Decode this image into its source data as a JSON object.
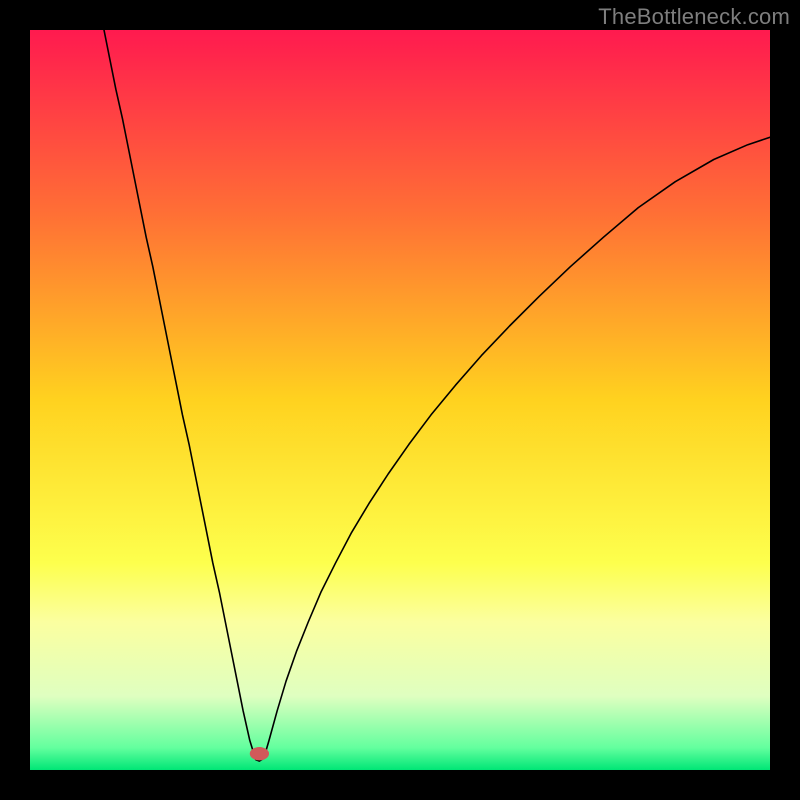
{
  "watermark": "TheBottleneck.com",
  "chart_data": {
    "type": "line",
    "title": "",
    "xlabel": "",
    "ylabel": "",
    "xlim": [
      0,
      100
    ],
    "ylim": [
      0,
      100
    ],
    "grid": false,
    "gradient_stops": [
      {
        "offset": 0,
        "color": "#ff1a4f"
      },
      {
        "offset": 0.25,
        "color": "#ff7035"
      },
      {
        "offset": 0.5,
        "color": "#ffd21f"
      },
      {
        "offset": 0.72,
        "color": "#fdff4d"
      },
      {
        "offset": 0.8,
        "color": "#fbffa0"
      },
      {
        "offset": 0.9,
        "color": "#dfffc0"
      },
      {
        "offset": 0.97,
        "color": "#63ff9e"
      },
      {
        "offset": 1.0,
        "color": "#00e676"
      }
    ],
    "marker": {
      "x": 31,
      "y": 2.2,
      "rx": 1.3,
      "ry": 0.9,
      "color": "#d05a5a"
    },
    "series": [
      {
        "name": "curve",
        "stroke": "#000000",
        "stroke_width": 1.6,
        "points": [
          {
            "x": 10.0,
            "y": 100.0
          },
          {
            "x": 10.8,
            "y": 96.0
          },
          {
            "x": 11.6,
            "y": 92.0
          },
          {
            "x": 12.5,
            "y": 88.0
          },
          {
            "x": 13.3,
            "y": 84.0
          },
          {
            "x": 14.1,
            "y": 80.0
          },
          {
            "x": 14.9,
            "y": 76.0
          },
          {
            "x": 15.7,
            "y": 72.0
          },
          {
            "x": 16.6,
            "y": 68.0
          },
          {
            "x": 17.4,
            "y": 64.0
          },
          {
            "x": 18.2,
            "y": 60.0
          },
          {
            "x": 19.0,
            "y": 56.0
          },
          {
            "x": 19.8,
            "y": 52.0
          },
          {
            "x": 20.6,
            "y": 48.0
          },
          {
            "x": 21.5,
            "y": 44.0
          },
          {
            "x": 22.3,
            "y": 40.0
          },
          {
            "x": 23.1,
            "y": 36.0
          },
          {
            "x": 23.9,
            "y": 32.0
          },
          {
            "x": 24.7,
            "y": 28.0
          },
          {
            "x": 25.6,
            "y": 24.0
          },
          {
            "x": 26.4,
            "y": 20.0
          },
          {
            "x": 27.2,
            "y": 16.0
          },
          {
            "x": 28.0,
            "y": 12.0
          },
          {
            "x": 28.8,
            "y": 8.0
          },
          {
            "x": 29.7,
            "y": 4.0
          },
          {
            "x": 30.5,
            "y": 1.4
          },
          {
            "x": 31.0,
            "y": 1.2
          },
          {
            "x": 31.6,
            "y": 1.6
          },
          {
            "x": 32.3,
            "y": 4.0
          },
          {
            "x": 33.4,
            "y": 8.0
          },
          {
            "x": 34.6,
            "y": 12.0
          },
          {
            "x": 36.0,
            "y": 16.0
          },
          {
            "x": 37.6,
            "y": 20.0
          },
          {
            "x": 39.3,
            "y": 24.0
          },
          {
            "x": 41.3,
            "y": 28.0
          },
          {
            "x": 43.4,
            "y": 32.0
          },
          {
            "x": 45.8,
            "y": 36.0
          },
          {
            "x": 48.4,
            "y": 40.0
          },
          {
            "x": 51.2,
            "y": 44.0
          },
          {
            "x": 54.2,
            "y": 48.0
          },
          {
            "x": 57.5,
            "y": 52.0
          },
          {
            "x": 61.0,
            "y": 56.0
          },
          {
            "x": 64.8,
            "y": 60.0
          },
          {
            "x": 68.8,
            "y": 64.0
          },
          {
            "x": 73.0,
            "y": 68.0
          },
          {
            "x": 77.5,
            "y": 72.0
          },
          {
            "x": 82.2,
            "y": 76.0
          },
          {
            "x": 87.2,
            "y": 79.5
          },
          {
            "x": 92.4,
            "y": 82.5
          },
          {
            "x": 97.0,
            "y": 84.5
          },
          {
            "x": 100.0,
            "y": 85.5
          }
        ]
      }
    ]
  }
}
